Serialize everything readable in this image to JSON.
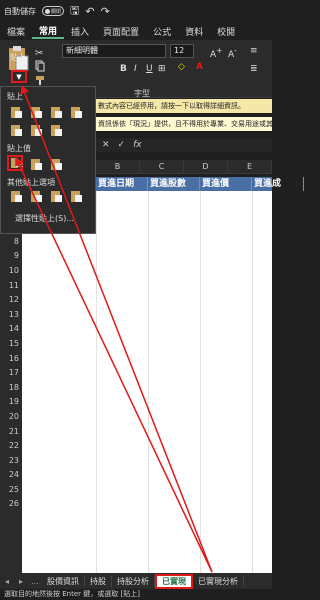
{
  "qat": {
    "autosave": "自動儲存",
    "toggle": "關閉"
  },
  "tabs": [
    "檔案",
    "常用",
    "插入",
    "頁面配置",
    "公式",
    "資料",
    "校閱"
  ],
  "ribbon": {
    "paste_label": "貼上",
    "font_name": "新細明體",
    "font_size": "12",
    "group_font": "字型"
  },
  "notices": {
    "line1": "數式內容已經停用，請按一下以取得詳細資訊。",
    "line2": "資訊係依「現況」提供，且不得用於專業、交易用途或其他類似用途。"
  },
  "formula": {
    "cancel": "✕",
    "enter": "✓",
    "fx": "fx"
  },
  "columns": [
    "B",
    "C",
    "D",
    "E"
  ],
  "header_row": {
    "c1": "買進日期",
    "c2": "買進股數",
    "c3": "買進價",
    "c4": "買進成"
  },
  "row_numbers": [
    "5",
    "6",
    "7",
    "8",
    "9",
    "10",
    "11",
    "12",
    "13",
    "14",
    "15",
    "16",
    "17",
    "18",
    "19",
    "20",
    "21",
    "22",
    "23",
    "24",
    "25",
    "26"
  ],
  "popup": {
    "s1": "貼上",
    "s2": "貼上值",
    "s3": "其他貼上選項",
    "s4": "選擇性貼上(S)..."
  },
  "sheets": [
    "股價資訊",
    "持股",
    "持股分析",
    "已實現",
    "已實現分析"
  ],
  "status": "選取目的地然後按 Enter 鍵，或選取 [貼上]",
  "colors": {
    "accent": "#e01a1a",
    "table_header": "#4a6fa5",
    "excel_green": "#217346"
  }
}
